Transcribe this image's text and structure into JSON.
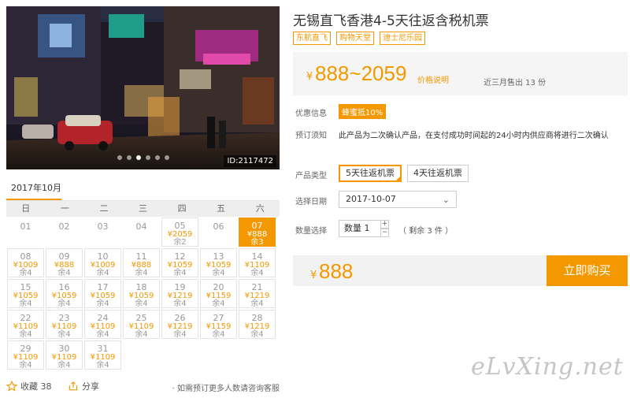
{
  "photo": {
    "id_label": "ID:2117472",
    "dots": 6,
    "active_dot": 3
  },
  "calendar": {
    "month": "2017年10月",
    "weekdays": [
      "日",
      "一",
      "二",
      "三",
      "四",
      "五",
      "六"
    ],
    "days": [
      {
        "d": "01"
      },
      {
        "d": "02"
      },
      {
        "d": "03"
      },
      {
        "d": "04"
      },
      {
        "d": "05",
        "p": "¥2059",
        "r": "余2"
      },
      {
        "d": "06"
      },
      {
        "d": "07",
        "p": "¥888",
        "r": "余3",
        "selected": true
      },
      {
        "d": "08",
        "p": "¥1009",
        "r": "余4"
      },
      {
        "d": "09",
        "p": "¥888",
        "r": "余4"
      },
      {
        "d": "10",
        "p": "¥1009",
        "r": "余4"
      },
      {
        "d": "11",
        "p": "¥888",
        "r": "余4"
      },
      {
        "d": "12",
        "p": "¥1059",
        "r": "余4"
      },
      {
        "d": "13",
        "p": "¥1059",
        "r": "余4"
      },
      {
        "d": "14",
        "p": "¥1109",
        "r": "余4"
      },
      {
        "d": "15",
        "p": "¥1059",
        "r": "余4"
      },
      {
        "d": "16",
        "p": "¥1059",
        "r": "余4"
      },
      {
        "d": "17",
        "p": "¥1059",
        "r": "余4"
      },
      {
        "d": "18",
        "p": "¥1059",
        "r": "余4"
      },
      {
        "d": "19",
        "p": "¥1219",
        "r": "余4"
      },
      {
        "d": "20",
        "p": "¥1159",
        "r": "余4"
      },
      {
        "d": "21",
        "p": "¥1219",
        "r": "余4"
      },
      {
        "d": "22",
        "p": "¥1109",
        "r": "余4"
      },
      {
        "d": "23",
        "p": "¥1109",
        "r": "余4"
      },
      {
        "d": "24",
        "p": "¥1109",
        "r": "余4"
      },
      {
        "d": "25",
        "p": "¥1109",
        "r": "余4"
      },
      {
        "d": "26",
        "p": "¥1219",
        "r": "余4"
      },
      {
        "d": "27",
        "p": "¥1159",
        "r": "余4"
      },
      {
        "d": "28",
        "p": "¥1219",
        "r": "余4"
      },
      {
        "d": "29",
        "p": "¥1109",
        "r": "余4"
      },
      {
        "d": "30",
        "p": "¥1109",
        "r": "余4"
      },
      {
        "d": "31",
        "p": "¥1109",
        "r": "余4"
      }
    ]
  },
  "footer": {
    "fav_label": "收藏 38",
    "share_label": "分享",
    "consult": "· 如需预订更多人数请咨询客服"
  },
  "product": {
    "title": "无锡直飞香港4-5天往返含税机票",
    "tags": [
      "东航直飞",
      "购物天堂",
      "迪士尼乐园"
    ],
    "price_currency": "¥",
    "price_range": "888~2059",
    "price_note": "价格说明",
    "sold": "近三月售出 13 份",
    "promo_label": "优惠信息",
    "promo": "蜂蜜抵10%",
    "booking_label": "预订须知",
    "booking": "此产品为二次确认产品，在支付成功时间起的24小时内供应商将进行二次确认",
    "type_label": "产品类型",
    "types": [
      "5天往返机票",
      "4天往返机票"
    ],
    "date_label": "选择日期",
    "date_value": "2017-10-07",
    "qty_label": "数量选择",
    "qty_value": "数量  1",
    "stepper_plus": "+",
    "stepper_minus": "−",
    "stock": "（ 剩余 3 件 ）",
    "total_currency": "¥",
    "total": "888",
    "buy": "立即购买"
  },
  "watermark": "eLvXing.net",
  "colors": {
    "accent": "#f39800"
  }
}
